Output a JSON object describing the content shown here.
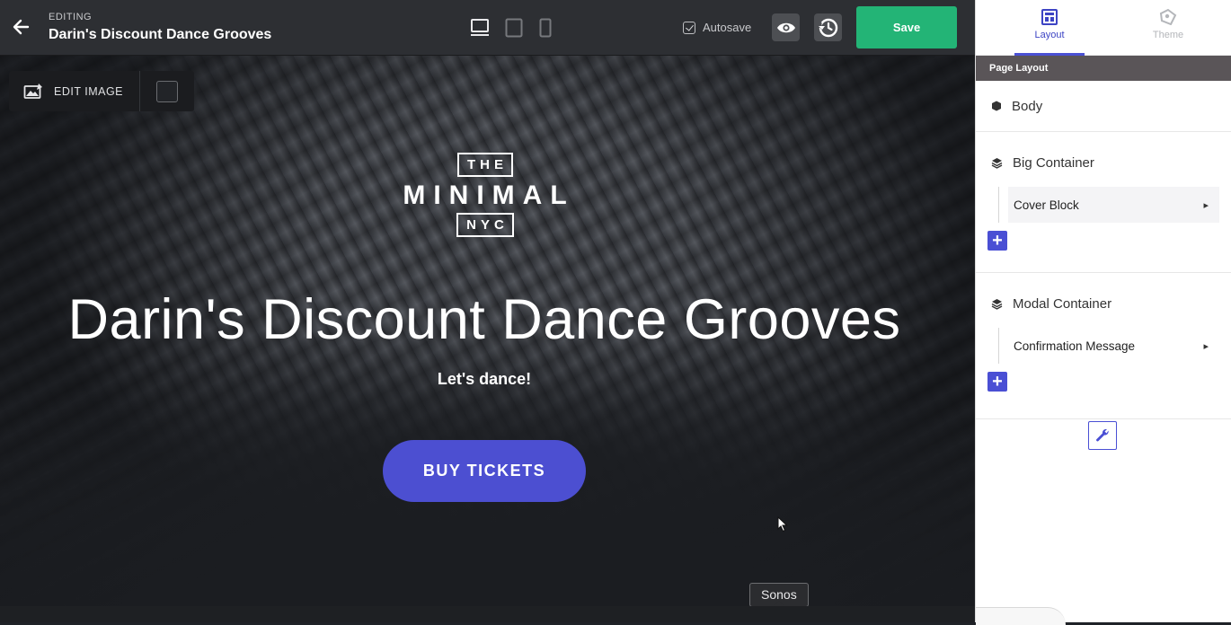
{
  "header": {
    "editing_label": "EDITING",
    "page_name": "Darin's Discount Dance Grooves",
    "autosave_label": "Autosave",
    "autosave_checked": true,
    "save_label": "Save",
    "devices": [
      "desktop-icon",
      "tablet-icon",
      "mobile-icon"
    ],
    "accent_color": "#23b476"
  },
  "canvas": {
    "edit_image_label": "EDIT IMAGE",
    "logo": {
      "top": "THE",
      "main": "MINIMAL",
      "bottom": "NYC"
    },
    "title": "Darin's Discount Dance Grooves",
    "subtitle": "Let's dance!",
    "cta_label": "BUY TICKETS",
    "cta_color": "#4c4fd1",
    "tooltip": "Sonos"
  },
  "panel": {
    "tabs": [
      {
        "label": "Layout",
        "icon": "layout-icon",
        "active": true
      },
      {
        "label": "Theme",
        "icon": "theme-icon",
        "active": false
      }
    ],
    "section_title": "Page Layout",
    "body_label": "Body",
    "groups": [
      {
        "label": "Big Container",
        "children": [
          "Cover Block"
        ]
      },
      {
        "label": "Modal Container",
        "children": [
          "Confirmation Message"
        ]
      }
    ]
  }
}
